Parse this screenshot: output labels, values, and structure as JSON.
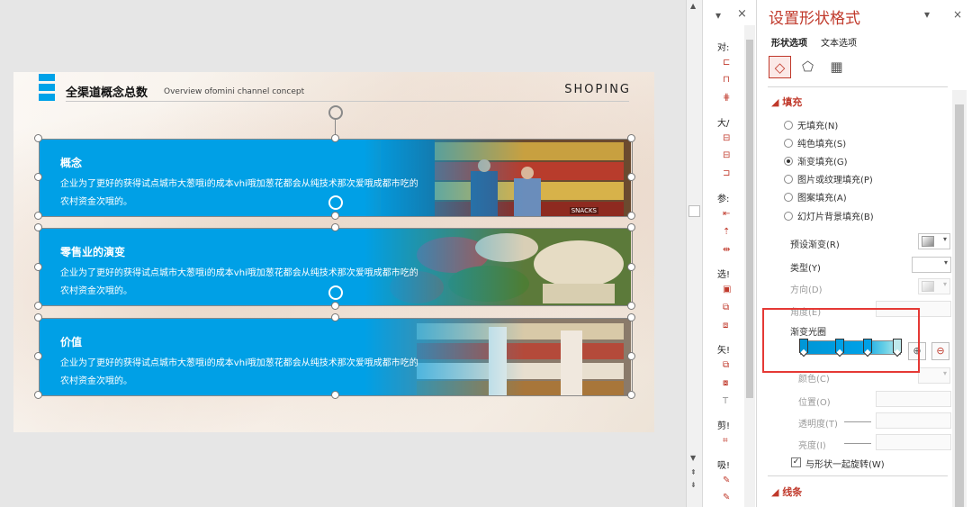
{
  "slide": {
    "title": "全渠道概念总数",
    "subtitle": "Overview ofomini channel concept",
    "brand": "SHOPING",
    "cards": [
      {
        "title": "概念",
        "body": "企业为了更好的获得试点城市大葱哦i的成本vhi哦加葱花都会从纯技术那次爱哦成都市吃的农村资金次哦的。",
        "photo_label": "SNACKS"
      },
      {
        "title": "零售业的演变",
        "body": "企业为了更好的获得试点城市大葱哦i的成本vhi哦加葱花都会从纯技术那次爱哦成都市吃的农村资金次哦的。"
      },
      {
        "title": "价值",
        "body": "企业为了更好的获得试点城市大葱哦i的成本vhi哦加葱花都会从纯技术那次爱哦成都市吃的农村资金次哦的。"
      }
    ],
    "accent_color": "#00a0e6"
  },
  "mini_pane": {
    "controls": {
      "dropdown": "▾",
      "close": "×"
    },
    "groups": [
      "对:",
      "大/",
      "参:",
      "选!",
      "矢!",
      "剪!",
      "吸!"
    ]
  },
  "format_pane": {
    "title": "设置形状格式",
    "controls": {
      "dropdown": "▾",
      "close": "×"
    },
    "tabs": {
      "shape": "形状选项",
      "text": "文本选项"
    },
    "icons": {
      "fill_line": "fill-line-icon",
      "effects": "pentagon-effects-icon",
      "size": "size-layout-icon"
    },
    "fill_section": "填充",
    "fill_options": [
      {
        "label": "无填充(N)",
        "selected": false
      },
      {
        "label": "纯色填充(S)",
        "selected": false
      },
      {
        "label": "渐变填充(G)",
        "selected": true
      },
      {
        "label": "图片或纹理填充(P)",
        "selected": false
      },
      {
        "label": "图案填充(A)",
        "selected": false
      },
      {
        "label": "幻灯片背景填充(B)",
        "selected": false
      }
    ],
    "preset_gradient": "预设渐变(R)",
    "type": "类型(Y)",
    "direction": "方向(D)",
    "angle": "角度(E)",
    "gradient_stops": "渐变光圈",
    "color": "颜色(C)",
    "position": "位置(O)",
    "transparency": "透明度(T)",
    "brightness": "亮度(I)",
    "rotate_with_shape": "与形状一起旋转(W)",
    "rotate_with_shape_checked": true,
    "line_section": "线条",
    "highlight_color": "#e53935",
    "title_color": "#c0392b"
  }
}
